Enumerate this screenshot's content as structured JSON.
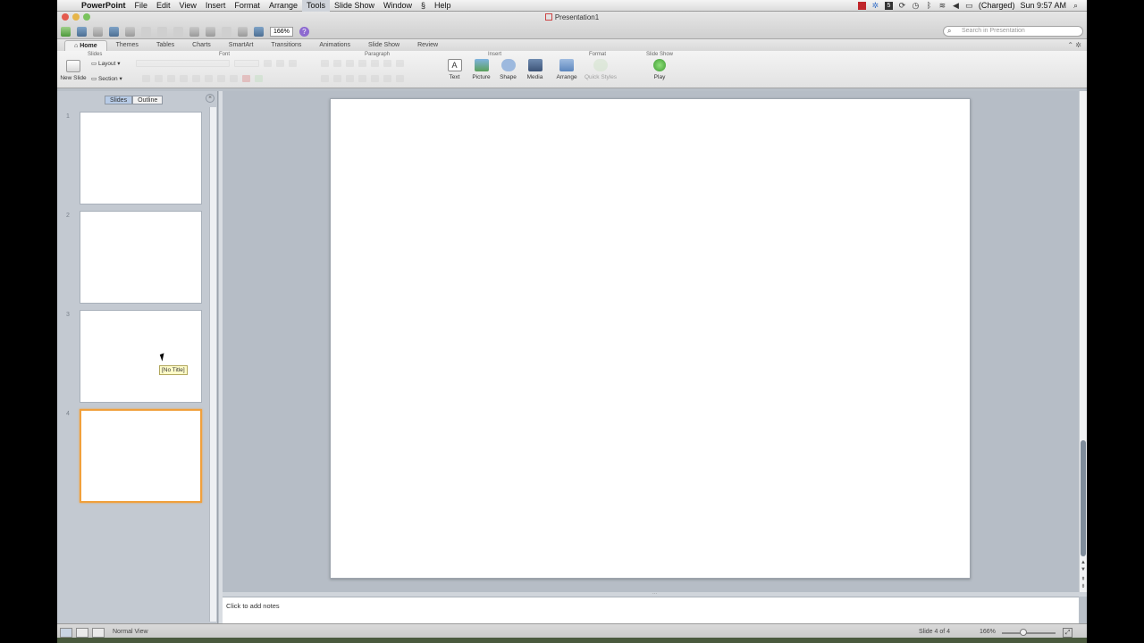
{
  "menubar": {
    "app": "PowerPoint",
    "items": [
      "File",
      "Edit",
      "View",
      "Insert",
      "Format",
      "Arrange",
      "Tools",
      "Slide Show",
      "Window",
      "Help"
    ],
    "active": "Tools",
    "battery": "(Charged)",
    "clock": "Sun 9:57 AM"
  },
  "window": {
    "title": "Presentation1",
    "zoom": "166%",
    "search_placeholder": "Search in Presentation"
  },
  "ribbon": {
    "tabs": [
      "Home",
      "Themes",
      "Tables",
      "Charts",
      "SmartArt",
      "Transitions",
      "Animations",
      "Slide Show",
      "Review"
    ],
    "selected_tab": "Home",
    "groups": {
      "slides": "Slides",
      "font": "Font",
      "paragraph": "Paragraph",
      "insert": "Insert",
      "format": "Format",
      "slideshow": "Slide Show"
    },
    "new_slide": "New Slide",
    "layout": "Layout",
    "section": "Section",
    "text": "Text",
    "picture": "Picture",
    "shape": "Shape",
    "media": "Media",
    "arrange": "Arrange",
    "quick_styles": "Quick Styles",
    "play": "Play"
  },
  "leftpane": {
    "tabs": [
      "Slides",
      "Outline"
    ],
    "selected": "Slides",
    "slides": [
      "1",
      "2",
      "3",
      "4"
    ],
    "selected_slide": 4,
    "tooltip": "[No Title]"
  },
  "notes": {
    "placeholder": "Click to add notes"
  },
  "status": {
    "view": "Normal View",
    "slide_count": "Slide 4 of 4",
    "zoom": "166%"
  },
  "colors": {
    "selection": "#f0a03c",
    "canvas": "#ffffff",
    "workspace": "#b6bdc6"
  }
}
